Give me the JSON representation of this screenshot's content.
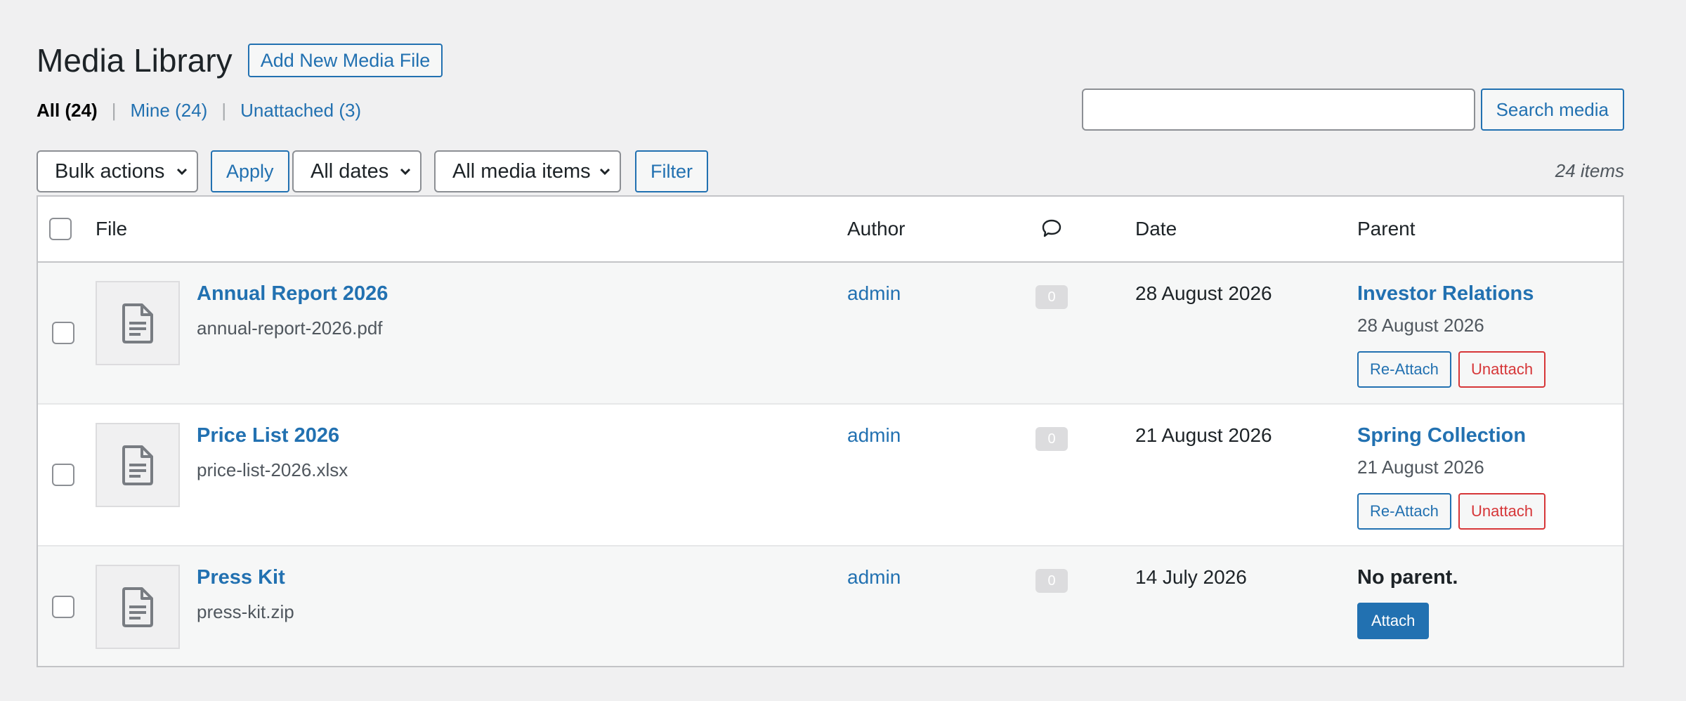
{
  "page": {
    "title": "Media Library",
    "add_new_label": "Add New Media File"
  },
  "views": [
    {
      "label": "All",
      "count": "(24)"
    },
    {
      "label": "Mine",
      "count": "(24)"
    },
    {
      "label": "Unattached",
      "count": "(3)"
    }
  ],
  "search": {
    "value": "",
    "button_label": "Search media"
  },
  "tablenav": {
    "bulk_actions": "Bulk actions",
    "apply_label": "Apply",
    "dates_filter": "All dates",
    "media_type_filter": "All media items",
    "filter_label": "Filter",
    "items_count": "24 items"
  },
  "table": {
    "columns": {
      "file": "File",
      "author": "Author",
      "comments_icon": "comment-icon",
      "date": "Date",
      "parent": "Parent"
    },
    "rows": [
      {
        "title": "Annual Report 2026",
        "filename": "annual-report-2026.pdf",
        "author": "admin",
        "comments": "0",
        "date": "28 August 2026",
        "parent_title": "Investor Relations",
        "parent_date": "28 August 2026",
        "reattach_label": "Re-Attach",
        "unattach_label": "Unattach"
      },
      {
        "title": "Price List 2026",
        "filename": "price-list-2026.xlsx",
        "author": "admin",
        "comments": "0",
        "date": "21 August 2026",
        "parent_title": "Spring Collection",
        "parent_date": "21 August 2026",
        "reattach_label": "Re-Attach",
        "unattach_label": "Unattach"
      },
      {
        "title": "Press Kit",
        "filename": "press-kit.zip",
        "author": "admin",
        "comments": "0",
        "date": "14 July 2026",
        "no_parent_label": "No parent.",
        "attach_label": "Attach"
      }
    ]
  },
  "colors": {
    "link": "#2271b1",
    "danger": "#d63638",
    "background": "#f0f0f1"
  }
}
